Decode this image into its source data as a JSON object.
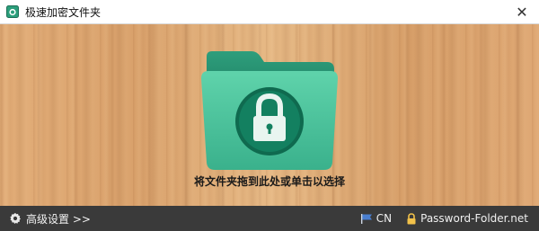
{
  "window": {
    "title": "极速加密文件夹",
    "close_glyph": "✕"
  },
  "main": {
    "folder_icon": "locked-folder-icon",
    "drop_hint": "将文件夹拖到此处或单击以选择"
  },
  "bottom": {
    "settings_label": "高级设置 >>",
    "language_label": "CN",
    "website_label": "Password-Folder.net"
  },
  "colors": {
    "folder_green": "#3fb894",
    "folder_dark": "#1f8a69",
    "lock_circle": "#0f6a4f",
    "bar_bg": "#3a3a3a"
  }
}
